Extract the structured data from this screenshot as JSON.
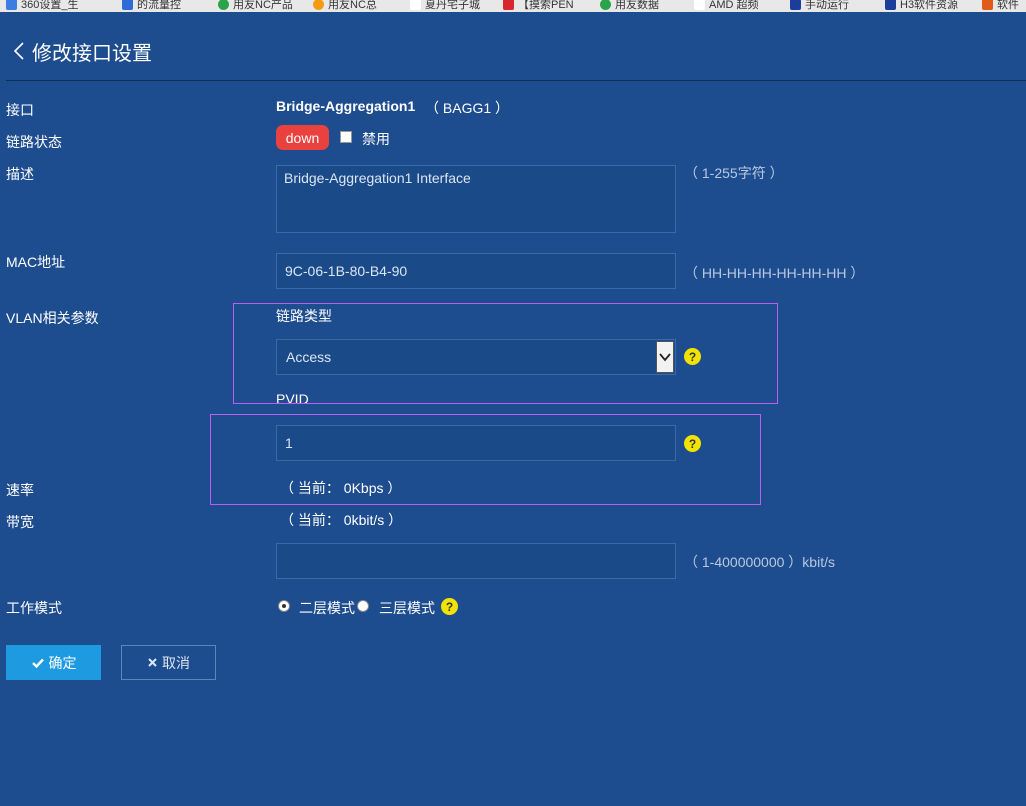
{
  "bookmarks": [
    {
      "label": "360设置_生",
      "color": "#3b7de0"
    },
    {
      "label": "的流量控",
      "color": "#2d6bd6"
    },
    {
      "label": "用友NC产品",
      "color": "#2aa34a"
    },
    {
      "label": "用友NC总",
      "color": "#f39c12"
    },
    {
      "label": "夏丹宅子城",
      "color": "#ffffff"
    },
    {
      "label": "【摸索PEN",
      "color": "#d9262c"
    },
    {
      "label": "用友数据",
      "color": "#2aa34a"
    },
    {
      "label": "AMD 超频",
      "color": "#ffffff"
    },
    {
      "label": "手动运行",
      "color": "#1b3e9b"
    },
    {
      "label": "H3软件资源",
      "color": "#1b3e9b"
    },
    {
      "label": "软件",
      "color": "#e05a1a"
    }
  ],
  "header": {
    "title": "修改接口设置",
    "back_icon": "chevron-left-icon"
  },
  "form": {
    "interface": {
      "label": "接口",
      "name": "Bridge-Aggregation1",
      "alias": "（ BAGG1 ）"
    },
    "link_status": {
      "label": "链路状态",
      "status": "down",
      "status_color": "#e9413e",
      "disable_label": "禁用",
      "disabled": false
    },
    "description": {
      "label": "描述",
      "value": "Bridge-Aggregation1 Interface",
      "hint": "（ 1-255字符 ）"
    },
    "mac": {
      "label": "MAC地址",
      "value": "9C-06-1B-80-B4-90",
      "hint": "（ HH-HH-HH-HH-HH-HH ）"
    },
    "vlan": {
      "label": "VLAN相关参数",
      "link_type_label": "链路类型",
      "link_type_value": "Access",
      "pvid_label": "PVID",
      "pvid_value": "1"
    },
    "speed": {
      "label": "速率",
      "current": "（ 当前： 0Kbps ）"
    },
    "bandwidth": {
      "label": "带宽",
      "current": "（ 当前： 0kbit/s ）",
      "value": "",
      "hint": "（ 1-400000000 ）kbit/s"
    },
    "work_mode": {
      "label": "工作模式",
      "layer2_label": "二层模式",
      "layer3_label": "三层模式",
      "selected": "二层模式"
    }
  },
  "buttons": {
    "ok": "确定",
    "cancel": "取消"
  },
  "colors": {
    "background": "#1e4d8f",
    "highlight_border": "#c05cf2",
    "primary_button": "#1e9be0",
    "help_icon": "#f2e400"
  }
}
